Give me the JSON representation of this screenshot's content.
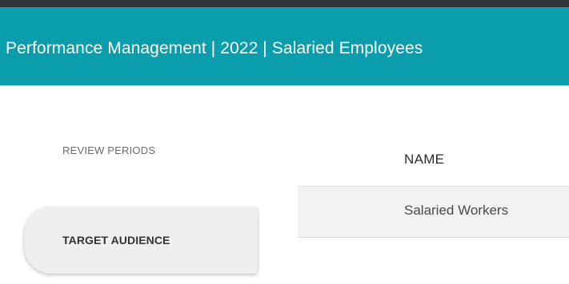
{
  "header": {
    "title": "Performance Management | 2022 | Salaried Employees"
  },
  "sidebar": {
    "items": [
      {
        "label": "REVIEW PERIODS",
        "active": false
      },
      {
        "label": "TARGET AUDIENCE",
        "active": true
      }
    ]
  },
  "table": {
    "columns": [
      "NAME"
    ],
    "rows": [
      [
        "Salaried Workers"
      ]
    ]
  },
  "colors": {
    "header_bg": "#0a9dac",
    "top_strip": "#2f3337",
    "active_nav_bg": "#efefef",
    "row_bg": "#f2f2f2"
  }
}
